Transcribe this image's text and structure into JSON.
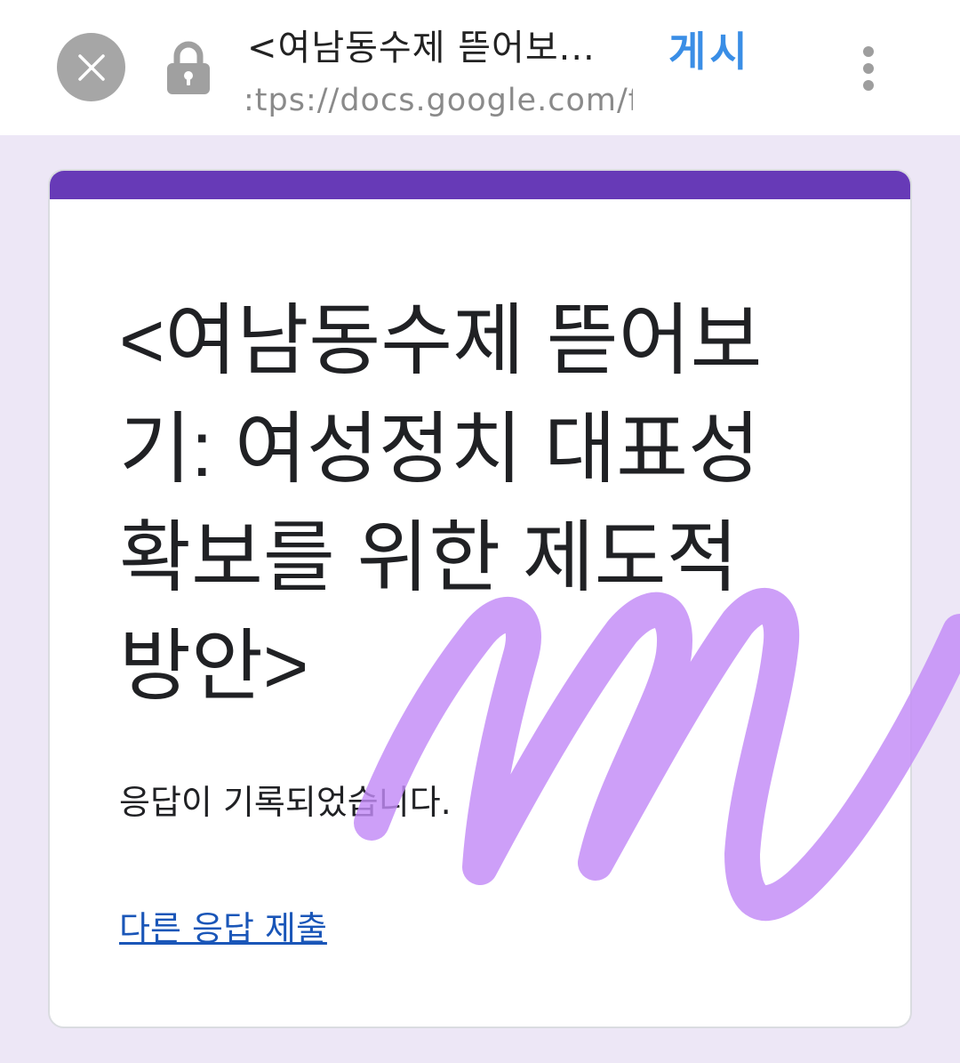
{
  "browser": {
    "page_title": "<여남동수제 뜯어보...",
    "url": ":tps://docs.google.com/f",
    "post_label": "게시",
    "icons": {
      "close": "close-icon",
      "lock": "lock-icon",
      "menu": "more-vert-icon"
    }
  },
  "form": {
    "title": "<여남동수제 뜯어보기: 여성정치 대표성 확보를 위한 제도적 방안>",
    "confirmation": "응답이 기록되었습니다.",
    "submit_another_label": "다른 응답 제출",
    "accent_color": "#673ab7"
  },
  "colors": {
    "background": "#ede7f6",
    "link": "#1a56b8",
    "scribble": "#c28af7"
  }
}
